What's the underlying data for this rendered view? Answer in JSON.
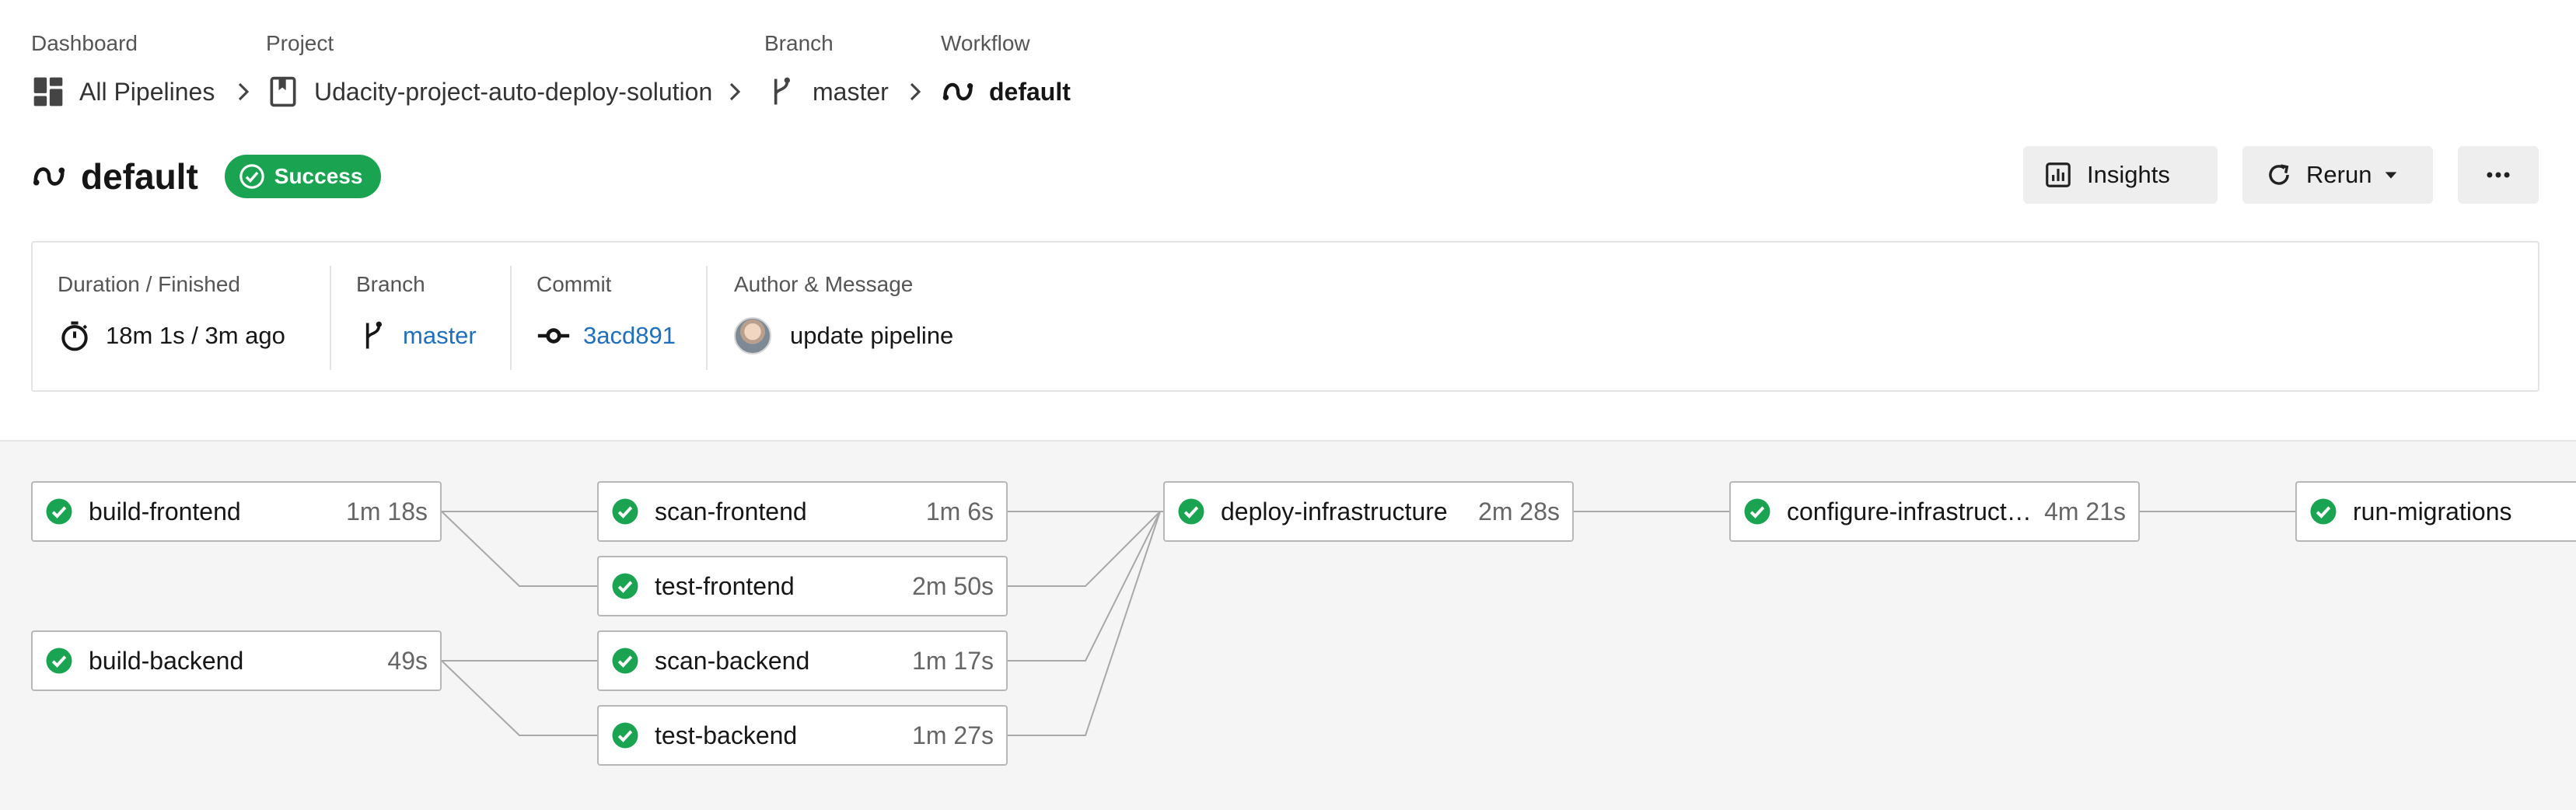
{
  "breadcrumb": {
    "dashboard": {
      "label": "Dashboard",
      "value": "All Pipelines",
      "icon": "dashboard-icon"
    },
    "project": {
      "label": "Project",
      "value": "Udacity-project-auto-deploy-solution",
      "icon": "bookmark-icon"
    },
    "branch": {
      "label": "Branch",
      "value": "master",
      "icon": "branch-icon"
    },
    "workflow": {
      "label": "Workflow",
      "value": "default",
      "icon": "workflow-icon"
    }
  },
  "header": {
    "title": "default",
    "status": "Success",
    "insights_label": "Insights",
    "rerun_label": "Rerun",
    "more_icon": "more-icon"
  },
  "info": {
    "duration": {
      "label": "Duration / Finished",
      "value": "18m 1s / 3m ago"
    },
    "branch": {
      "label": "Branch",
      "value": "master"
    },
    "commit": {
      "label": "Commit",
      "value": "3acd891"
    },
    "author": {
      "label": "Author & Message",
      "value": "update pipeline"
    }
  },
  "colors": {
    "success": "#1aa350",
    "link": "#1f6fbf",
    "canvas": "#f5f5f5"
  },
  "jobs": [
    {
      "name": "build-frontend",
      "duration": "1m 18s"
    },
    {
      "name": "build-backend",
      "duration": "49s"
    },
    {
      "name": "scan-frontend",
      "duration": "1m 6s"
    },
    {
      "name": "test-frontend",
      "duration": "2m 50s"
    },
    {
      "name": "scan-backend",
      "duration": "1m 17s"
    },
    {
      "name": "test-backend",
      "duration": "1m 27s"
    },
    {
      "name": "deploy-infrastructure",
      "duration": "2m 28s"
    },
    {
      "name": "configure-infrastructu...",
      "duration": "4m 21s"
    },
    {
      "name": "run-migrations",
      "duration": ""
    }
  ]
}
